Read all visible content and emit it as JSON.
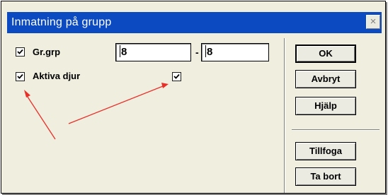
{
  "window": {
    "title": "Inmatning på grupp",
    "close_glyph": "×"
  },
  "form": {
    "grgrp": {
      "label": "Gr.grp",
      "checked": true,
      "from_value": "8",
      "separator": "-",
      "to_value": "8"
    },
    "aktiva_djur": {
      "label": "Aktiva djur",
      "checked": true,
      "second_checkbox_checked": true
    }
  },
  "buttons": {
    "ok": "OK",
    "cancel": "Avbryt",
    "help": "Hjälp",
    "append": "Tillfoga",
    "remove": "Ta bort"
  },
  "annotation": {
    "arrow_color": "#e8302a"
  },
  "colors": {
    "titlebar": "#0c4ac2",
    "dialog_face": "#f0eede",
    "button_face": "#ecebe2"
  }
}
